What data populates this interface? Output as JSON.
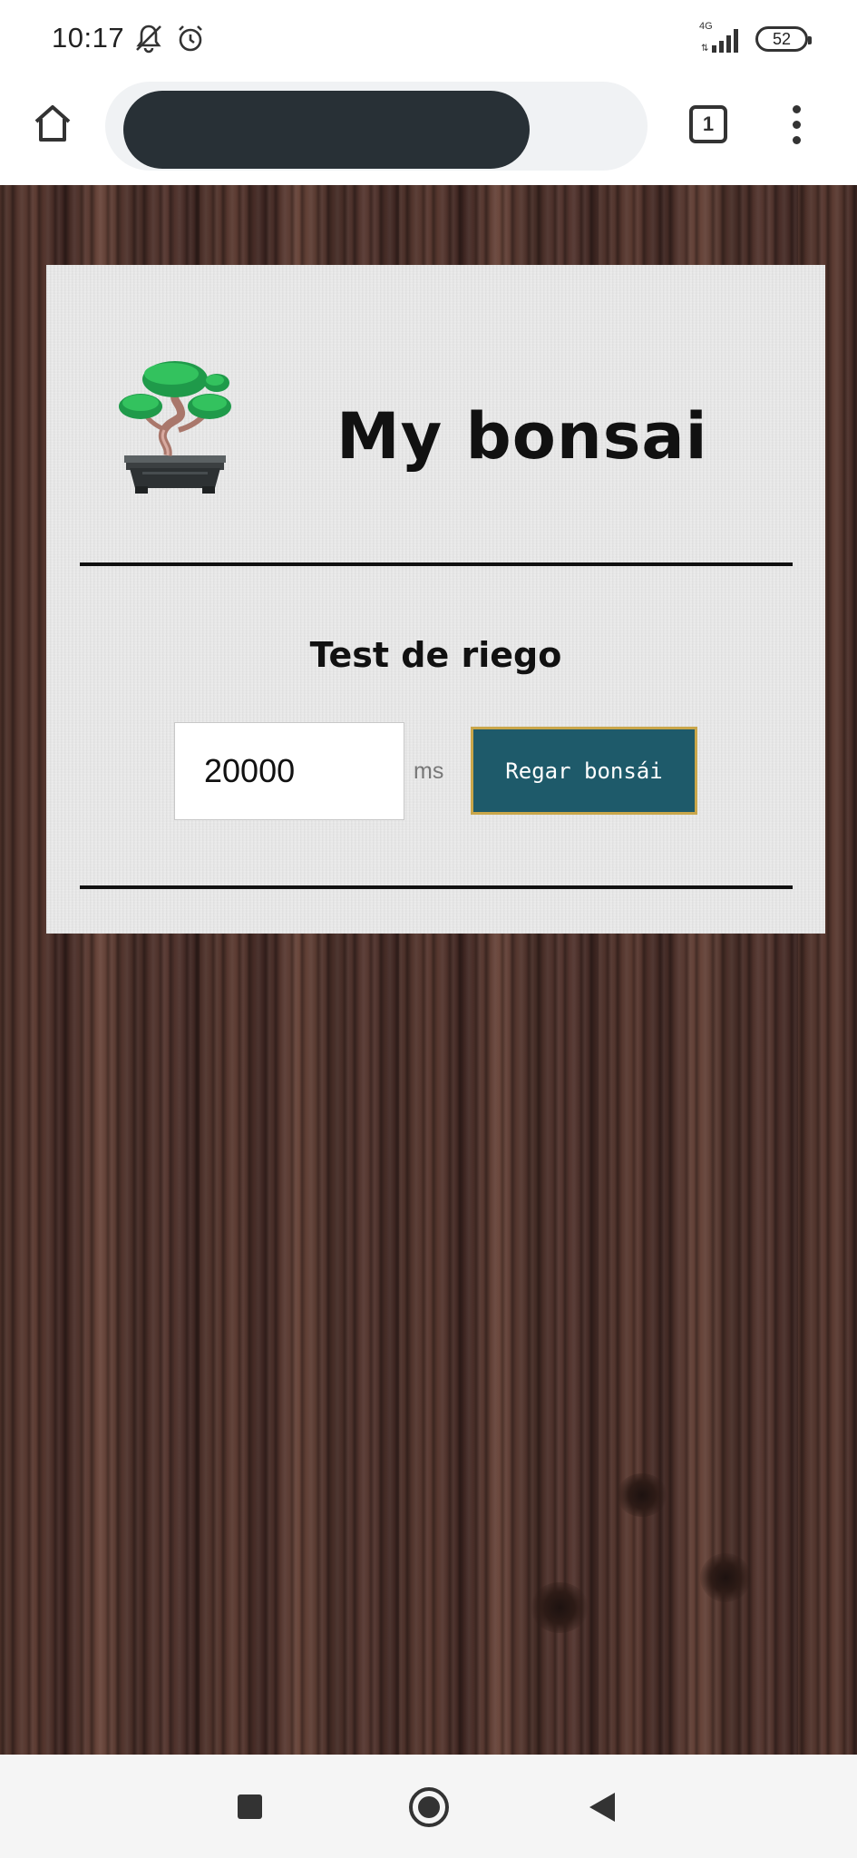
{
  "status_bar": {
    "time": "10:17",
    "network_type": "4G",
    "battery_level": "52",
    "icons": [
      "notifications-muted-icon",
      "alarm-icon",
      "signal-icon",
      "battery-icon"
    ]
  },
  "browser": {
    "tab_count": "1",
    "icons": [
      "home-icon",
      "tab-switcher-icon",
      "overflow-menu-icon"
    ]
  },
  "page": {
    "title": "My bonsai",
    "section_title": "Test de riego",
    "duration_input": {
      "value": "20000",
      "placeholder": ""
    },
    "unit_label": "ms",
    "water_button_label": "Regar bonsái",
    "colors": {
      "card_background": "#ececec",
      "button_background": "#1e5a6a",
      "button_border": "#c9a64a",
      "wood_background": "#4b3029"
    }
  },
  "nav_bar": {
    "icons": [
      "recents-icon",
      "home-circle-icon",
      "back-icon"
    ]
  }
}
